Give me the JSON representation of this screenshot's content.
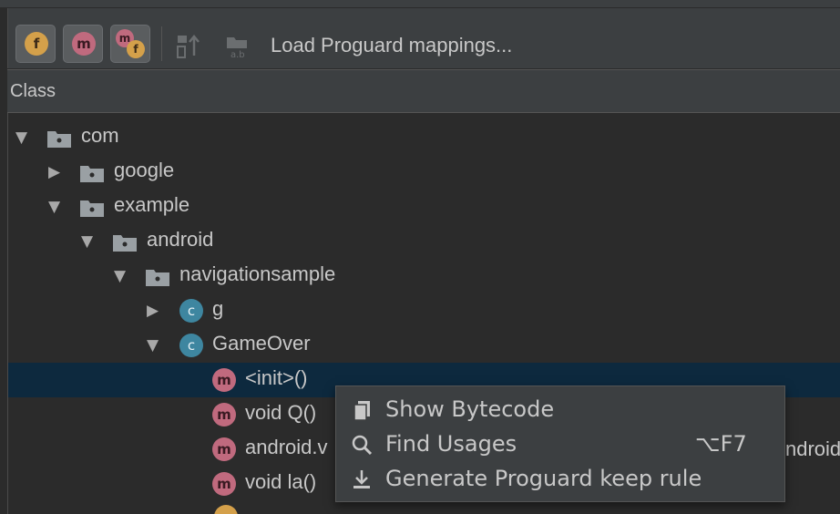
{
  "toolbar": {
    "buttons": [
      {
        "name": "filter-fields-button",
        "badge": "f"
      },
      {
        "name": "filter-methods-button",
        "badge": "m"
      },
      {
        "name": "filter-referenced-button",
        "badge": "m",
        "badge2": "f"
      }
    ],
    "load_label": "Load Proguard mappings..."
  },
  "header": {
    "column": "Class"
  },
  "tree": {
    "rows": [
      {
        "label": "com",
        "arrow": "▼",
        "kind": "folder"
      },
      {
        "label": "google",
        "arrow": "▶",
        "kind": "folder"
      },
      {
        "label": "example",
        "arrow": "▼",
        "kind": "folder"
      },
      {
        "label": "android",
        "arrow": "▼",
        "kind": "folder"
      },
      {
        "label": "navigationsample",
        "arrow": "▼",
        "kind": "folder"
      },
      {
        "label": "g",
        "arrow": "▶",
        "kind": "class",
        "badge": "c"
      },
      {
        "label": "GameOver",
        "arrow": "▼",
        "kind": "class",
        "badge": "c"
      },
      {
        "label": "<init>()",
        "kind": "method",
        "badge": "m",
        "selected": true
      },
      {
        "label": "void Q()",
        "kind": "method",
        "badge": "m"
      },
      {
        "label": "android.v",
        "kind": "method",
        "badge": "m",
        "trailing": "ndroid"
      },
      {
        "label": "void la()",
        "kind": "method",
        "badge": "m"
      }
    ]
  },
  "context_menu": {
    "items": [
      {
        "label": "Show Bytecode",
        "icon": "bytecode-icon",
        "shortcut": ""
      },
      {
        "label": "Find Usages",
        "icon": "search-icon",
        "shortcut": "⌥F7"
      },
      {
        "label": "Generate Proguard keep rule",
        "icon": "download-icon",
        "shortcut": ""
      }
    ]
  },
  "colors": {
    "background": "#2b2b2b",
    "panel": "#3c3f41",
    "selection": "#0d293e",
    "class_badge": "#3e86a0",
    "method_badge": "#c06a7e",
    "field_badge": "#d4a04a"
  }
}
